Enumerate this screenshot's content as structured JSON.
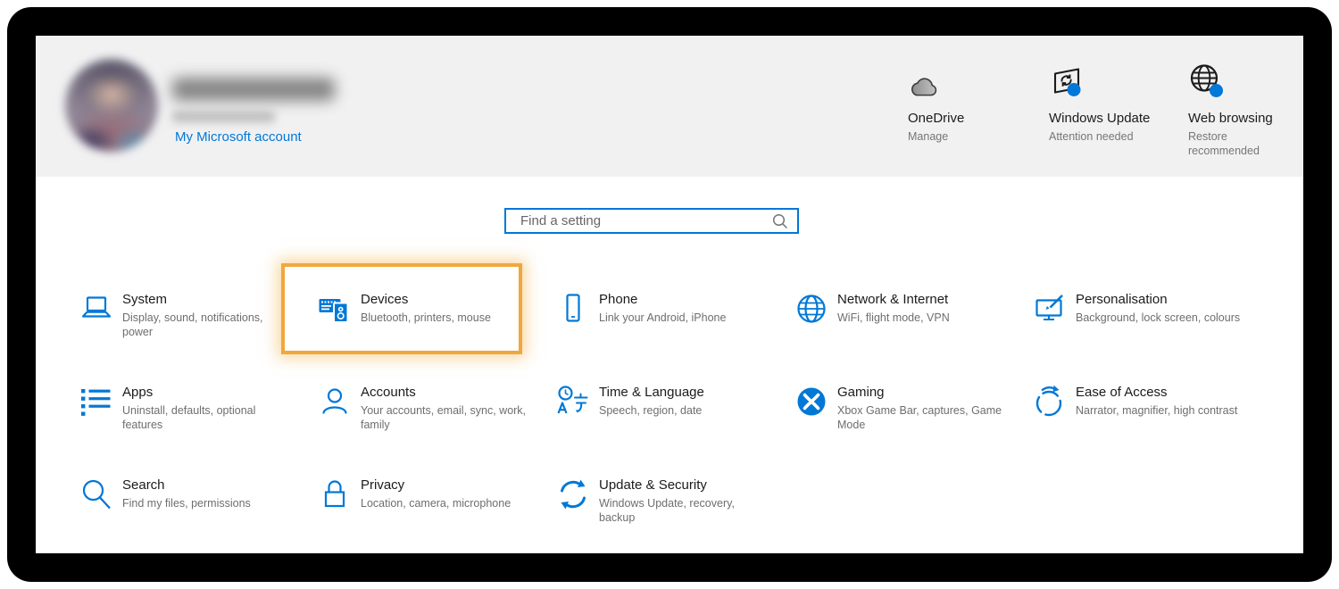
{
  "account": {
    "link_label": "My Microsoft account"
  },
  "quick_status": [
    {
      "title": "OneDrive",
      "subtitle": "Manage"
    },
    {
      "title": "Windows Update",
      "subtitle": "Attention needed"
    },
    {
      "title": "Web browsing",
      "subtitle": "Restore recommended"
    }
  ],
  "search": {
    "placeholder": "Find a setting"
  },
  "categories": [
    {
      "title": "System",
      "subtitle": "Display, sound, notifications, power"
    },
    {
      "title": "Devices",
      "subtitle": "Bluetooth, printers, mouse",
      "highlighted": true
    },
    {
      "title": "Phone",
      "subtitle": "Link your Android, iPhone"
    },
    {
      "title": "Network & Internet",
      "subtitle": "WiFi, flight mode, VPN"
    },
    {
      "title": "Personalisation",
      "subtitle": "Background, lock screen, colours"
    },
    {
      "title": "Apps",
      "subtitle": "Uninstall, defaults, optional features"
    },
    {
      "title": "Accounts",
      "subtitle": "Your accounts, email, sync, work, family"
    },
    {
      "title": "Time & Language",
      "subtitle": "Speech, region, date"
    },
    {
      "title": "Gaming",
      "subtitle": "Xbox Game Bar, captures, Game Mode"
    },
    {
      "title": "Ease of Access",
      "subtitle": "Narrator, magnifier, high contrast"
    },
    {
      "title": "Search",
      "subtitle": "Find my files, permissions"
    },
    {
      "title": "Privacy",
      "subtitle": "Location, camera, microphone"
    },
    {
      "title": "Update & Security",
      "subtitle": "Windows Update, recovery, backup"
    }
  ],
  "colors": {
    "accent": "#0078d7",
    "highlight_border": "#f0a73c",
    "header_bg": "#f1f1f2"
  }
}
